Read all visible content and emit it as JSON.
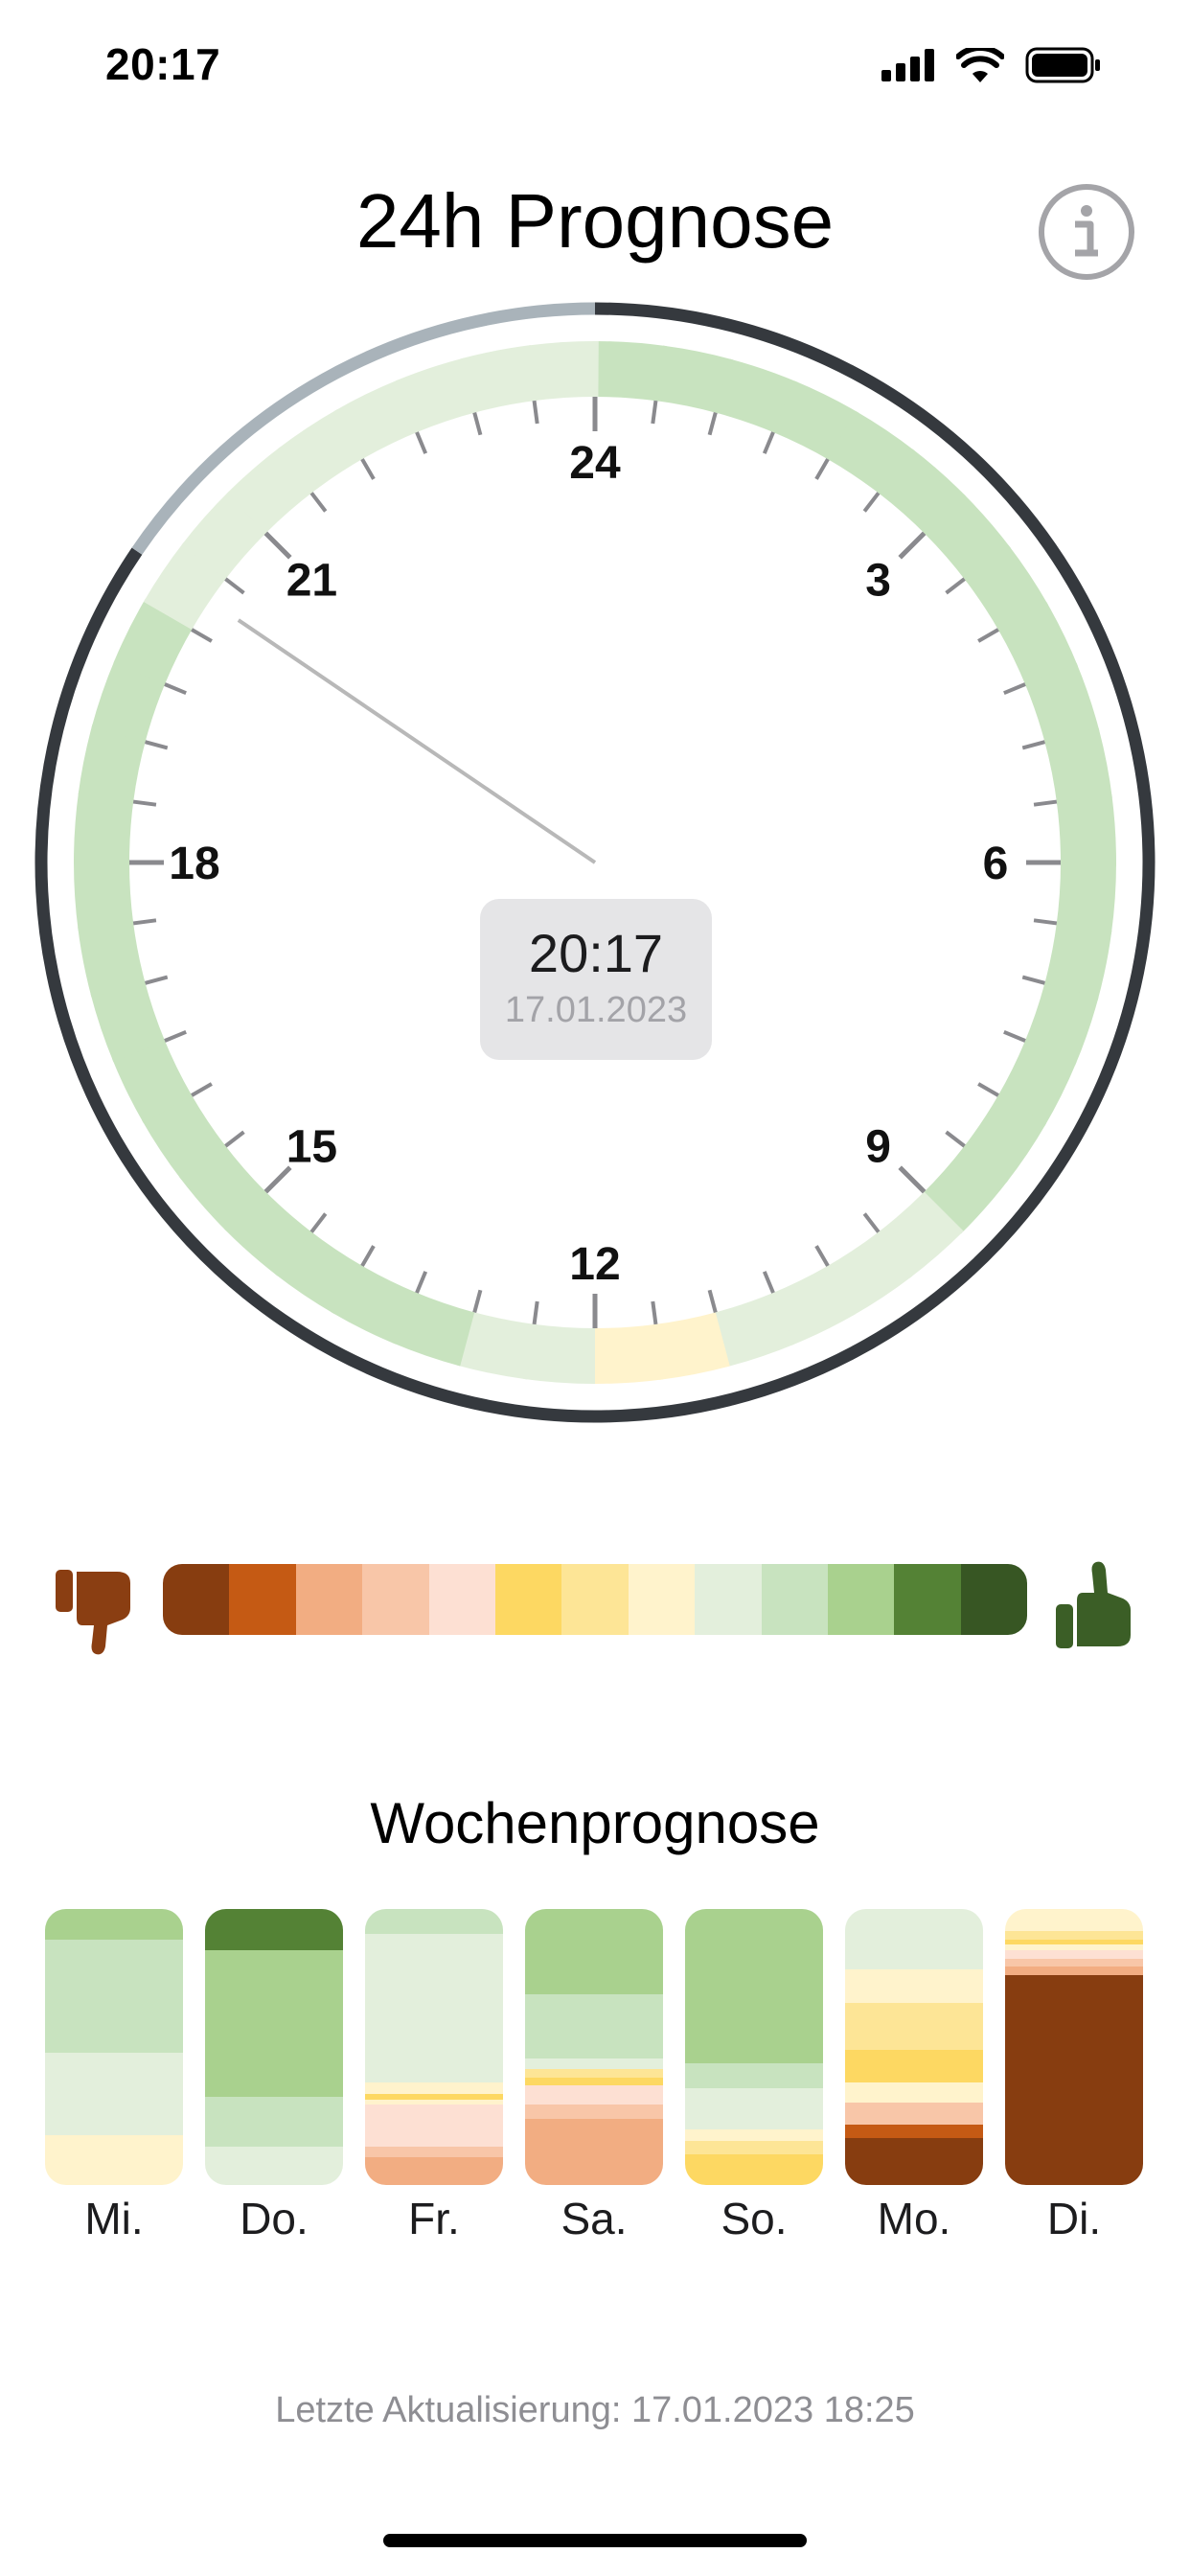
{
  "status_bar": {
    "time": "20:17",
    "signal_icon": "cellular-signal-icon",
    "wifi_icon": "wifi-icon",
    "battery_icon": "battery-icon"
  },
  "header": {
    "title": "24h Prognose",
    "info_icon": "info-icon"
  },
  "clock": {
    "hour_labels": [
      "24",
      "3",
      "6",
      "9",
      "12",
      "15",
      "18",
      "21"
    ],
    "center_time": "20:17",
    "center_date": "17.01.2023",
    "current_time_hours": 20.28,
    "hourly_ratings": [
      9,
      9,
      9,
      9,
      9,
      9,
      9,
      9,
      9,
      9,
      9,
      9,
      9,
      9,
      9,
      9,
      9,
      9,
      8,
      8,
      8,
      8,
      7,
      7,
      8,
      8,
      9,
      9,
      9,
      9,
      9,
      9,
      9,
      9,
      9,
      9,
      9,
      9,
      9,
      9,
      8,
      8,
      8,
      8,
      8,
      8,
      8,
      8
    ],
    "colors": {
      "outer_ring_past": "#a9b3ba",
      "outer_ring_future": "#35393e",
      "hand": "#b8b8b8",
      "tick": "#8a8a8e"
    }
  },
  "scale": {
    "bad_icon": "thumbs-down-icon",
    "good_icon": "thumbs-up-icon",
    "bad_icon_color": "#8a3e12",
    "good_icon_color": "#3b5e26",
    "colors": [
      "#873d10",
      "#c55a14",
      "#f2ad82",
      "#f8c6a8",
      "#fde0d3",
      "#fdd862",
      "#fde596",
      "#fff3cc",
      "#e3efdc",
      "#c8e3bf",
      "#a9d18e",
      "#548235",
      "#375623"
    ]
  },
  "week": {
    "title": "Wochenprognose",
    "days": [
      {
        "label": "Mi.",
        "segments": [
          {
            "r": 10,
            "s": 0.11
          },
          {
            "r": 9,
            "s": 0.41
          },
          {
            "r": 8,
            "s": 0.3
          },
          {
            "r": 7,
            "s": 0.18
          }
        ]
      },
      {
        "label": "Do.",
        "segments": [
          {
            "r": 11,
            "s": 0.15
          },
          {
            "r": 10,
            "s": 0.53
          },
          {
            "r": 9,
            "s": 0.18
          },
          {
            "r": 8,
            "s": 0.14
          }
        ]
      },
      {
        "label": "Fr.",
        "segments": [
          {
            "r": 9,
            "s": 0.09
          },
          {
            "r": 8,
            "s": 0.54
          },
          {
            "r": 7,
            "s": 0.04
          },
          {
            "r": 5,
            "s": 0.02
          },
          {
            "r": 7,
            "s": 0.02
          },
          {
            "r": 4,
            "s": 0.15
          },
          {
            "r": 3,
            "s": 0.04
          },
          {
            "r": 2,
            "s": 0.1
          }
        ]
      },
      {
        "label": "Sa.",
        "segments": [
          {
            "r": 10,
            "s": 0.31
          },
          {
            "r": 9,
            "s": 0.23
          },
          {
            "r": 8,
            "s": 0.04
          },
          {
            "r": 6,
            "s": 0.03
          },
          {
            "r": 5,
            "s": 0.03
          },
          {
            "r": 4,
            "s": 0.07
          },
          {
            "r": 3,
            "s": 0.05
          },
          {
            "r": 2,
            "s": 0.24
          }
        ]
      },
      {
        "label": "So.",
        "segments": [
          {
            "r": 10,
            "s": 0.56
          },
          {
            "r": 9,
            "s": 0.09
          },
          {
            "r": 8,
            "s": 0.15
          },
          {
            "r": 7,
            "s": 0.04
          },
          {
            "r": 6,
            "s": 0.05
          },
          {
            "r": 5,
            "s": 0.11
          }
        ]
      },
      {
        "label": "Mo.",
        "segments": [
          {
            "r": 8,
            "s": 0.22
          },
          {
            "r": 7,
            "s": 0.12
          },
          {
            "r": 6,
            "s": 0.17
          },
          {
            "r": 5,
            "s": 0.12
          },
          {
            "r": 7,
            "s": 0.07
          },
          {
            "r": 3,
            "s": 0.08
          },
          {
            "r": 1,
            "s": 0.05
          },
          {
            "r": 0,
            "s": 0.17
          }
        ]
      },
      {
        "label": "Di.",
        "segments": [
          {
            "r": 7,
            "s": 0.08
          },
          {
            "r": 6,
            "s": 0.03
          },
          {
            "r": 5,
            "s": 0.02
          },
          {
            "r": 7,
            "s": 0.02
          },
          {
            "r": 4,
            "s": 0.03
          },
          {
            "r": 3,
            "s": 0.03
          },
          {
            "r": 2,
            "s": 0.03
          },
          {
            "r": 0,
            "s": 0.76
          }
        ]
      }
    ]
  },
  "footer": {
    "text": "Letzte Aktualisierung: 17.01.2023 18:25"
  }
}
